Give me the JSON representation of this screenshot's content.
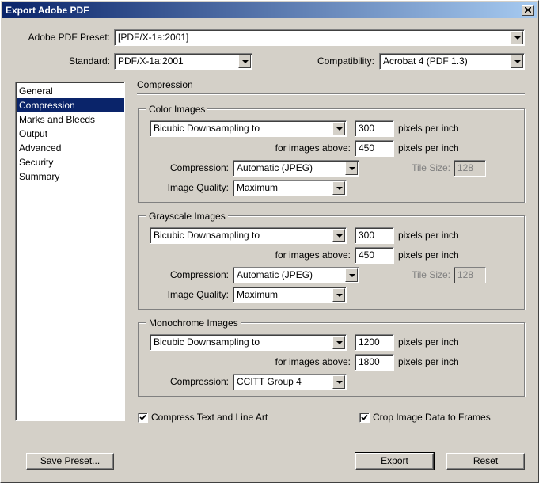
{
  "window": {
    "title": "Export Adobe PDF"
  },
  "preset": {
    "label": "Adobe PDF Preset:",
    "value": "[PDF/X-1a:2001]"
  },
  "standard": {
    "label": "Standard:",
    "value": "PDF/X-1a:2001"
  },
  "compatibility": {
    "label": "Compatibility:",
    "value": "Acrobat 4 (PDF 1.3)"
  },
  "sidebar": {
    "items": [
      "General",
      "Compression",
      "Marks and Bleeds",
      "Output",
      "Advanced",
      "Security",
      "Summary"
    ],
    "selected": "Compression"
  },
  "section_title": "Compression",
  "color": {
    "title": "Color Images",
    "method": "Bicubic Downsampling to",
    "ppi": "300",
    "ppi_label": "pixels per inch",
    "above_label": "for images above:",
    "above": "450",
    "above_unit": "pixels per inch",
    "compression_label": "Compression:",
    "compression": "Automatic (JPEG)",
    "tile_label": "Tile Size:",
    "tile": "128",
    "quality_label": "Image Quality:",
    "quality": "Maximum"
  },
  "gray": {
    "title": "Grayscale Images",
    "method": "Bicubic Downsampling to",
    "ppi": "300",
    "ppi_label": "pixels per inch",
    "above_label": "for images above:",
    "above": "450",
    "above_unit": "pixels per inch",
    "compression_label": "Compression:",
    "compression": "Automatic (JPEG)",
    "tile_label": "Tile Size:",
    "tile": "128",
    "quality_label": "Image Quality:",
    "quality": "Maximum"
  },
  "mono": {
    "title": "Monochrome Images",
    "method": "Bicubic Downsampling to",
    "ppi": "1200",
    "ppi_label": "pixels per inch",
    "above_label": "for images above:",
    "above": "1800",
    "above_unit": "pixels per inch",
    "compression_label": "Compression:",
    "compression": "CCITT Group 4"
  },
  "options": {
    "compress_text": {
      "label": "Compress Text and Line Art",
      "checked": true
    },
    "crop_image": {
      "label": "Crop Image Data to Frames",
      "checked": true
    }
  },
  "buttons": {
    "save_preset": "Save Preset...",
    "export": "Export",
    "reset": "Reset"
  }
}
